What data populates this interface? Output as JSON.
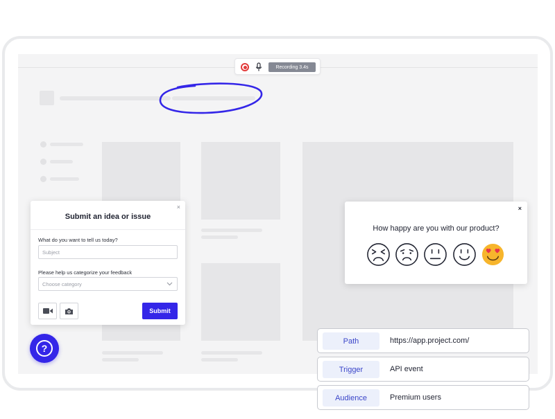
{
  "recording": {
    "label": "Recording 3.4s"
  },
  "idea_widget": {
    "title": "Submit an idea or issue",
    "close_label": "×",
    "question_label": "What do you want to tell us today?",
    "subject_placeholder": "Subject",
    "category_label": "Please help us categorize your feedback",
    "category_placeholder": "Choose category",
    "submit_label": "Submit",
    "icons": [
      "video-icon",
      "camera-icon"
    ]
  },
  "help_button": {
    "label": "?"
  },
  "survey_widget": {
    "close_label": "×",
    "question": "How happy are you with our product?",
    "faces": [
      "very-unhappy-face-icon",
      "unhappy-face-icon",
      "neutral-face-icon",
      "happy-face-icon",
      "heart-eyes-face-icon"
    ]
  },
  "targeting_rules": [
    {
      "key": "Path",
      "value": "https://app.project.com/"
    },
    {
      "key": "Trigger",
      "value": "API event"
    },
    {
      "key": "Audience",
      "value": "Premium users"
    }
  ],
  "colors": {
    "accent": "#3426e8",
    "recording_red": "#e23a3a",
    "placeholder_gray": "#e6e6e8",
    "emoji_yellow": "#f7b52c",
    "heart_red": "#e8344a"
  }
}
